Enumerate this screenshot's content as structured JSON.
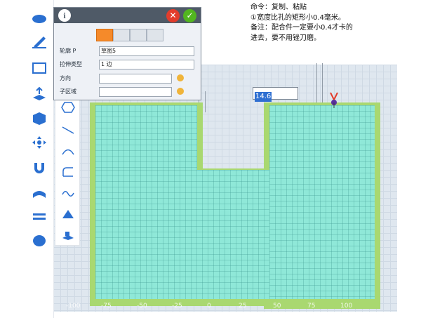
{
  "note": {
    "line1": "命令：复制、粘贴",
    "line2": "①宽度比孔的矩形小0.4毫米。",
    "line3": "备注：配合件一定要小0.4才卡的",
    "line4": "进去，要不用锉刀磨。"
  },
  "panel": {
    "fields": [
      {
        "label": "轮廓 P",
        "value": "草图5"
      },
      {
        "label": "拉伸类型",
        "value": "1 边"
      },
      {
        "label": "方向",
        "value": ""
      },
      {
        "label": "子区域",
        "value": ""
      }
    ]
  },
  "dimension": {
    "value": "14.6"
  },
  "ruler": {
    "ticks": [
      "-100",
      "-75",
      "-50",
      "-25",
      "0",
      "25",
      "50",
      "75",
      "100"
    ]
  },
  "colors": {
    "slab": "#8fe8d8",
    "edge": "#a9d870",
    "panel_header": "#4f5a67",
    "accent": "#f58a2a"
  }
}
